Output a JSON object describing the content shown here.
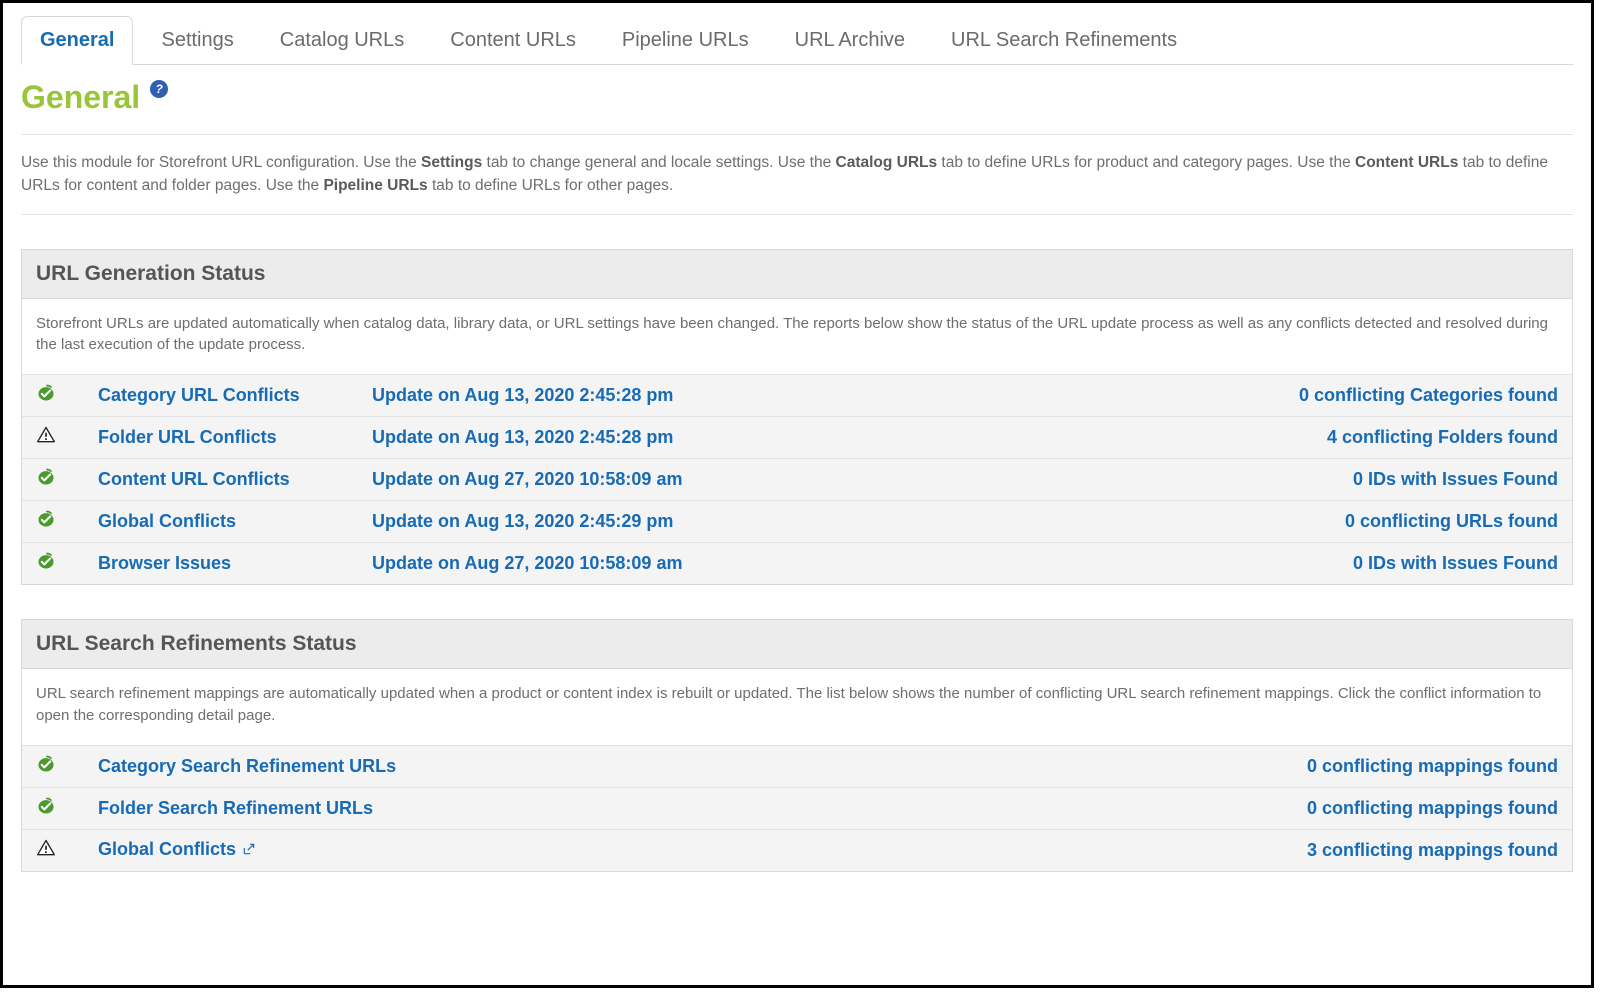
{
  "tabs": [
    {
      "label": "General",
      "active": true
    },
    {
      "label": "Settings",
      "active": false
    },
    {
      "label": "Catalog URLs",
      "active": false
    },
    {
      "label": "Content URLs",
      "active": false
    },
    {
      "label": "Pipeline URLs",
      "active": false
    },
    {
      "label": "URL Archive",
      "active": false
    },
    {
      "label": "URL Search Refinements",
      "active": false
    }
  ],
  "page_title": "General",
  "help_badge": "?",
  "intro": {
    "p1_a": "Use this module for Storefront URL configuration. Use the ",
    "b1": "Settings",
    "p1_b": " tab to change general and locale settings. Use the ",
    "b2": "Catalog URLs",
    "p1_c": " tab to define URLs for product and category pages. Use the ",
    "b3": "Content URLs",
    "p1_d": " tab to define URLs for content and folder pages. Use the ",
    "b4": "Pipeline URLs",
    "p1_e": " tab to define URLs for other pages."
  },
  "gen_status": {
    "header": "URL Generation Status",
    "desc": "Storefront URLs are updated automatically when catalog data, library data, or URL settings have been changed. The reports below show the status of the URL update process as well as any conflicts detected and resolved during the last execution of the update process.",
    "rows": [
      {
        "icon": "ok",
        "name": "Category URL Conflicts",
        "date": "Update on Aug 13, 2020 2:45:28 pm",
        "count": "0 conflicting Categories found"
      },
      {
        "icon": "warn",
        "name": "Folder URL Conflicts",
        "date": "Update on Aug 13, 2020 2:45:28 pm",
        "count": "4 conflicting Folders found"
      },
      {
        "icon": "ok",
        "name": "Content URL Conflicts",
        "date": "Update on Aug 27, 2020 10:58:09 am",
        "count": "0 IDs with Issues Found"
      },
      {
        "icon": "ok",
        "name": "Global Conflicts",
        "date": "Update on Aug 13, 2020 2:45:29 pm",
        "count": "0 conflicting URLs found"
      },
      {
        "icon": "ok",
        "name": "Browser Issues",
        "date": "Update on Aug 27, 2020 10:58:09 am",
        "count": "0 IDs with Issues Found"
      }
    ]
  },
  "refine_status": {
    "header": "URL Search Refinements Status",
    "desc": "URL search refinement mappings are automatically updated when a product or content index is rebuilt or updated. The list below shows the number of conflicting URL search refinement mappings. Click the conflict information to open the corresponding detail page.",
    "rows": [
      {
        "icon": "ok",
        "name": "Category Search Refinement URLs",
        "count": "0 conflicting mappings found",
        "popout": false
      },
      {
        "icon": "ok",
        "name": "Folder Search Refinement URLs",
        "count": "0 conflicting mappings found",
        "popout": false
      },
      {
        "icon": "warn",
        "name": "Global Conflicts",
        "count": "3 conflicting mappings found",
        "popout": true
      }
    ]
  }
}
